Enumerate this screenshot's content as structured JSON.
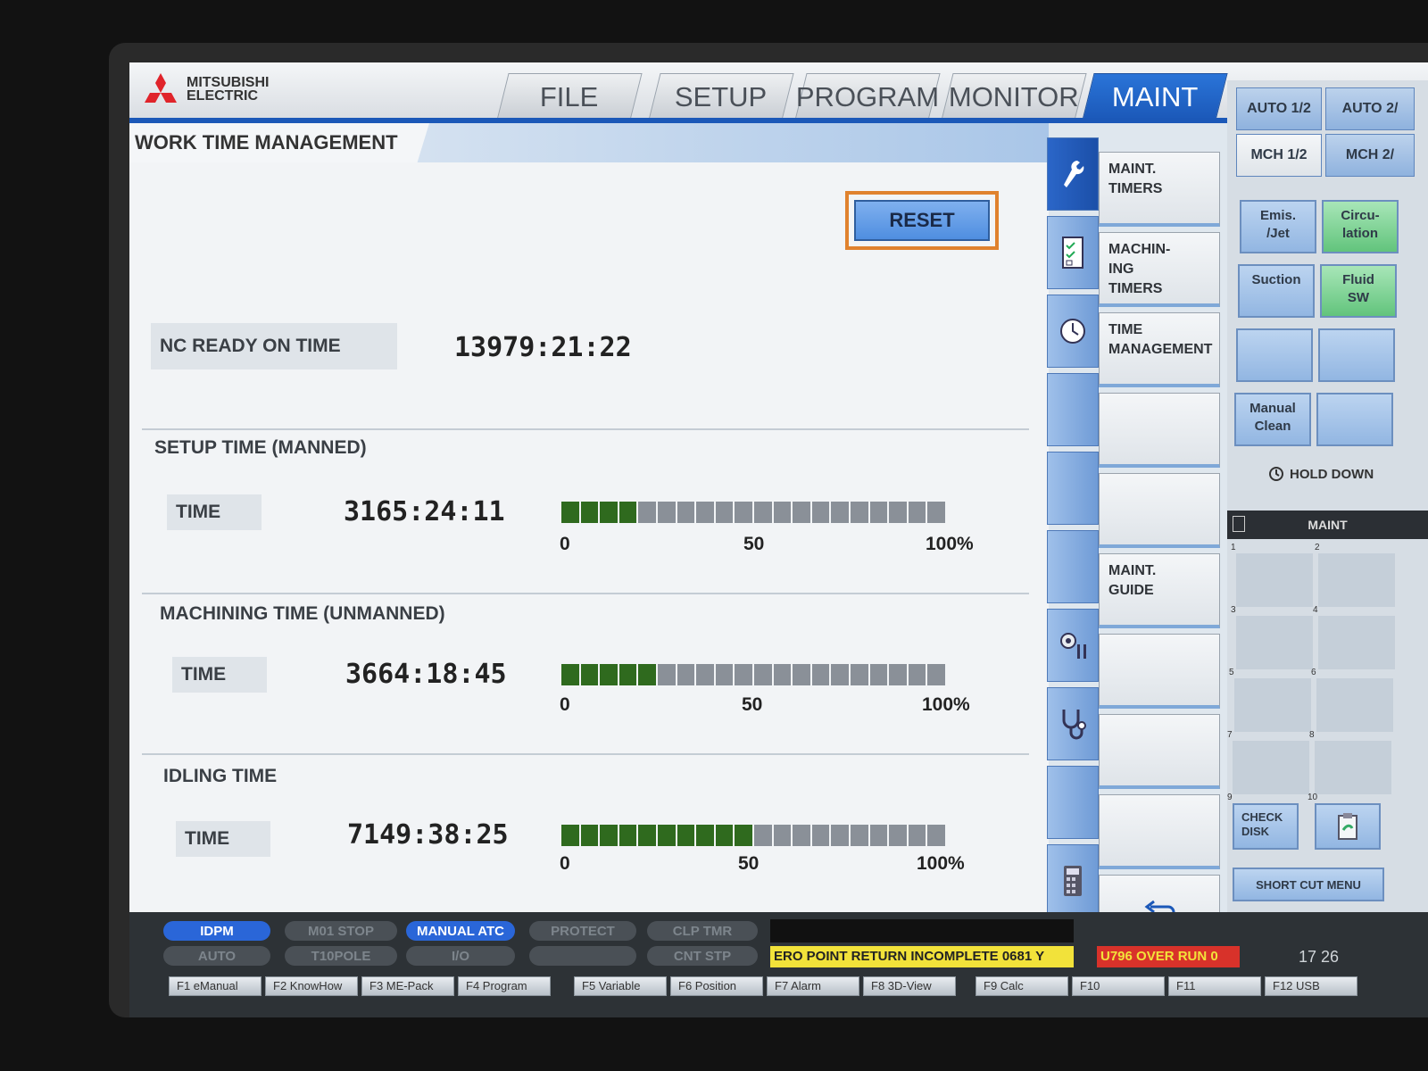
{
  "brand": {
    "line1": "MITSUBISHI",
    "line2": "ELECTRIC"
  },
  "tabs": [
    {
      "label": "FILE",
      "active": false
    },
    {
      "label": "SETUP",
      "active": false
    },
    {
      "label": "PROGRAM",
      "active": false
    },
    {
      "label": "MONITOR",
      "active": false
    },
    {
      "label": "MAINT",
      "active": true
    }
  ],
  "page_title": "WORK TIME MANAGEMENT",
  "reset_label": "RESET",
  "nc_ready": {
    "label": "NC READY ON TIME",
    "value": "13979:21:22"
  },
  "sections": [
    {
      "title": "SETUP TIME (MANNED)",
      "time_label": "TIME",
      "value": "3165:24:11",
      "progress_percent": 20
    },
    {
      "title": "MACHINING TIME (UNMANNED)",
      "time_label": "TIME",
      "value": "3664:18:45",
      "progress_percent": 25
    },
    {
      "title": "IDLING TIME",
      "time_label": "TIME",
      "value": "7149:38:25",
      "progress_percent": 50
    }
  ],
  "scale": {
    "min": "0",
    "mid": "50",
    "max": "100%"
  },
  "side_menu": [
    {
      "label": "MAINT.\nTIMERS"
    },
    {
      "label": "MACHIN-\nING\nTIMERS"
    },
    {
      "label": "TIME\nMANAGEMENT"
    },
    {
      "label": ""
    },
    {
      "label": ""
    },
    {
      "label": "MAINT.\nGUIDE"
    },
    {
      "label": ""
    },
    {
      "label": ""
    },
    {
      "label": ""
    }
  ],
  "right_tabs": {
    "auto1": "AUTO 1/2",
    "auto2": "AUTO 2/",
    "mch1": "MCH 1/2",
    "mch2": "MCH 2/"
  },
  "function_buttons": [
    {
      "label": "Emis.\n/Jet",
      "color": "blue"
    },
    {
      "label": "Circu-\nlation",
      "color": "green"
    },
    {
      "label": "Suction",
      "color": "blue"
    },
    {
      "label": "Fluid\nSW",
      "color": "green"
    },
    {
      "label": "",
      "color": "blue"
    },
    {
      "label": "",
      "color": "blue"
    },
    {
      "label": "Manual\nClean",
      "color": "blue"
    },
    {
      "label": "",
      "color": "blue"
    }
  ],
  "hold_down": "HOLD DOWN",
  "maint_header": "MAINT",
  "grid_numbers": [
    "1",
    "2",
    "3",
    "4",
    "5",
    "6",
    "7",
    "8",
    "9",
    "10"
  ],
  "check_disk": "CHECK\nDISK",
  "short_cut": "SHORT CUT MENU",
  "status_pills_row1": [
    {
      "label": "IDPM",
      "on": true
    },
    {
      "label": "M01 STOP",
      "on": false
    },
    {
      "label": "MANUAL ATC",
      "on": true
    },
    {
      "label": "PROTECT",
      "on": false
    },
    {
      "label": "CLP TMR",
      "on": false
    }
  ],
  "status_pills_row2": [
    {
      "label": "AUTO",
      "on": false
    },
    {
      "label": "T10POLE",
      "on": false
    },
    {
      "label": "I/O",
      "on": false
    },
    {
      "label": "",
      "on": false
    },
    {
      "label": "CNT STP",
      "on": false
    }
  ],
  "alarms": {
    "yellow": "ERO POINT RETURN INCOMPLETE 0681 Y",
    "red": "U796 OVER RUN 0"
  },
  "clock": "17 26",
  "function_keys": [
    "F1 eManual",
    "F2 KnowHow",
    "F3 ME-Pack",
    "F4 Program",
    "F5 Variable",
    "F6 Position",
    "F7 Alarm",
    "F8 3D-View",
    "F9 Calc",
    "F10",
    "F11",
    "F12 USB"
  ],
  "colors": {
    "accent": "#1b58b8",
    "progress_on": "#2f6a1e",
    "progress_off": "#8a9098",
    "reset_border": "#e0822e"
  }
}
